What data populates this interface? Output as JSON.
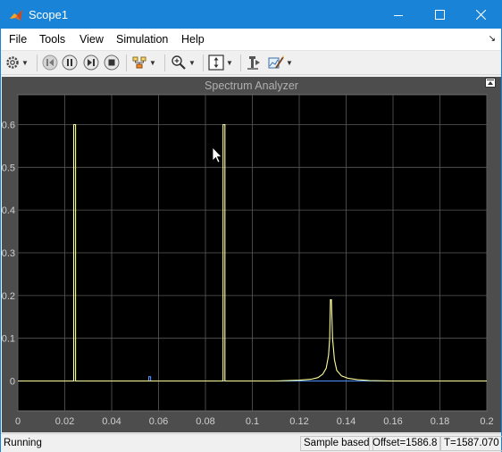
{
  "window": {
    "title": "Scope1"
  },
  "menu": [
    "File",
    "Tools",
    "View",
    "Simulation",
    "Help"
  ],
  "toolbar": {
    "icons": [
      "settings-icon",
      "step-back-icon",
      "pause-icon",
      "step-forward-icon",
      "stop-icon",
      "highlight-icon",
      "zoom-in-icon",
      "scale-axes-icon",
      "cursor-measurements-icon",
      "style-icon"
    ]
  },
  "plot": {
    "title": "Spectrum Analyzer"
  },
  "chart_data": {
    "type": "line",
    "title": "Spectrum Analyzer",
    "xlim": [
      0,
      0.2
    ],
    "ylim": [
      -0.07,
      0.67
    ],
    "x_ticks": [
      0,
      0.02,
      0.04,
      0.06,
      0.08,
      0.1,
      0.12,
      0.14,
      0.16,
      0.18,
      0.2
    ],
    "x_tick_labels": [
      "0",
      "0.02",
      "0.04",
      "0.06",
      "0.08",
      "0.1",
      "0.12",
      "0.14",
      "0.16",
      "0.18",
      "0.2"
    ],
    "y_ticks": [
      0,
      0.1,
      0.2,
      0.3,
      0.4,
      0.5,
      0.6
    ],
    "y_tick_labels": [
      "0",
      "0.1",
      "0.2",
      "0.3",
      "0.4",
      "0.5",
      "0.6"
    ],
    "grid": true,
    "background": "#000000",
    "series": [
      {
        "color": "#ffff99",
        "points": [
          [
            0,
            0
          ],
          [
            0.0238,
            0
          ],
          [
            0.0238,
            0.6
          ],
          [
            0.0246,
            0.6
          ],
          [
            0.0246,
            0
          ],
          [
            0.0875,
            0
          ],
          [
            0.0875,
            0.6
          ],
          [
            0.0883,
            0.6
          ],
          [
            0.0883,
            0
          ],
          [
            0.11,
            0
          ],
          [
            0.12,
            0.002
          ],
          [
            0.125,
            0.004
          ],
          [
            0.128,
            0.008
          ],
          [
            0.13,
            0.016
          ],
          [
            0.1315,
            0.03
          ],
          [
            0.1325,
            0.06
          ],
          [
            0.133,
            0.1
          ],
          [
            0.1333,
            0.19
          ],
          [
            0.1337,
            0.19
          ],
          [
            0.1342,
            0.1
          ],
          [
            0.135,
            0.05
          ],
          [
            0.136,
            0.025
          ],
          [
            0.138,
            0.012
          ],
          [
            0.141,
            0.006
          ],
          [
            0.145,
            0.003
          ],
          [
            0.15,
            0.001
          ],
          [
            0.16,
            0
          ],
          [
            0.2,
            0
          ]
        ]
      },
      {
        "color": "#4d90fe",
        "points": [
          [
            0,
            0
          ],
          [
            0.0558,
            0
          ],
          [
            0.0558,
            0.01
          ],
          [
            0.0566,
            0.01
          ],
          [
            0.0566,
            0
          ],
          [
            0.2,
            0
          ]
        ]
      }
    ]
  },
  "status": {
    "state": "Running",
    "mode": "Sample based",
    "offset": "Offset=1586.8",
    "time": "T=1587.070"
  }
}
